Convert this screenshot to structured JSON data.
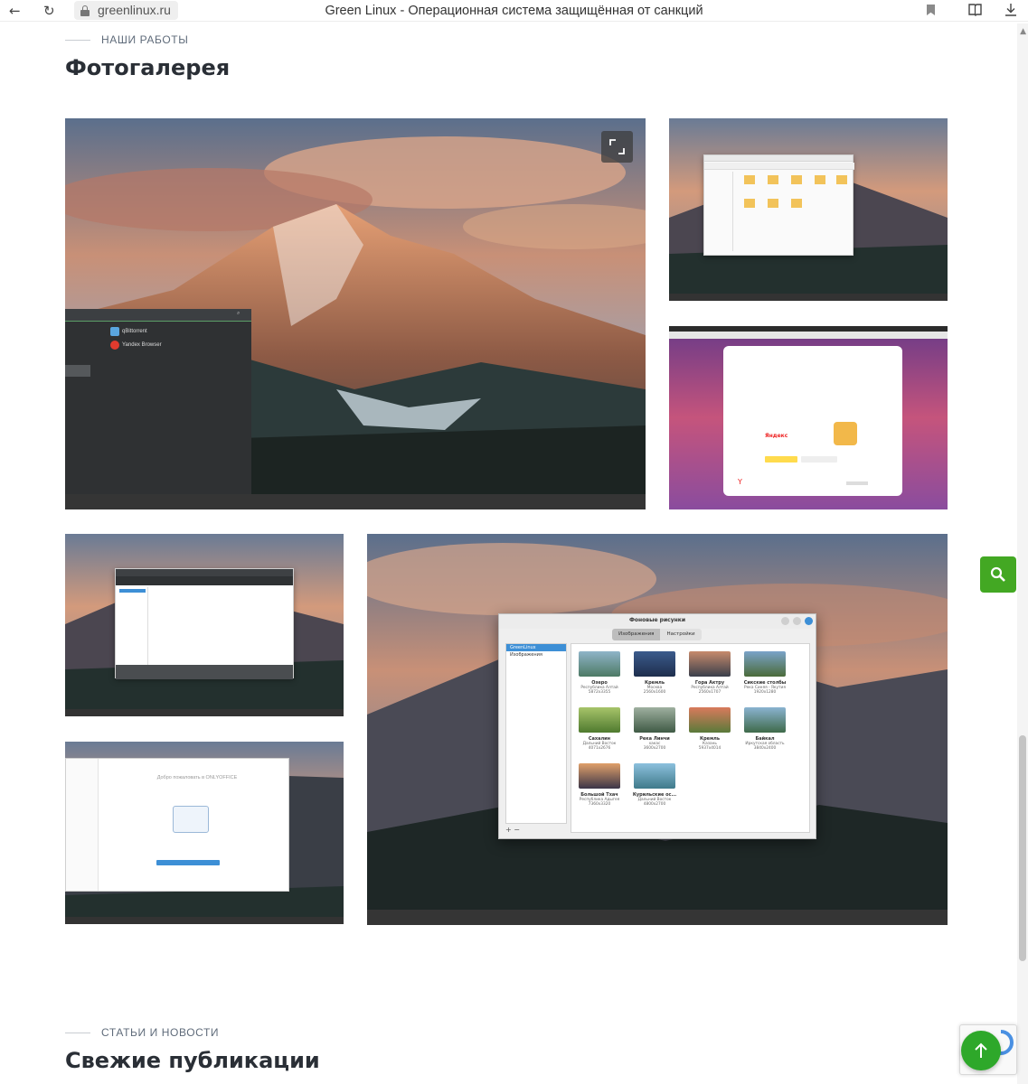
{
  "browser": {
    "url": "greenlinux.ru",
    "tab_title": "Green Linux - Операционная система защищённая от санкций"
  },
  "gallery": {
    "eyebrow": "НАШИ РАБОТЫ",
    "title": "Фотогалерея"
  },
  "tile_main": {
    "menu_items": [
      "qBittorrent",
      "Yandex Browser"
    ]
  },
  "tile_yandex": {
    "brand": "Яндекс"
  },
  "tile_wallpaper": {
    "dialog_title": "Фоновые рисунки",
    "tabs": [
      "Изображения",
      "Настройки"
    ],
    "sidebar": [
      "GreenLinux",
      "Изображения"
    ],
    "thumbs": [
      {
        "name": "Озеро",
        "sub1": "Республика Алтай",
        "sub2": "5872x3355"
      },
      {
        "name": "Кремль",
        "sub1": "Москва",
        "sub2": "2560x1600"
      },
      {
        "name": "Гора Актру",
        "sub1": "Республика Алтай",
        "sub2": "2560x1707"
      },
      {
        "name": "Сикские столбы",
        "sub1": "Река Синяя - Якутия",
        "sub2": "1920x1280"
      },
      {
        "name": "Сахалин",
        "sub1": "Дальний Восток",
        "sub2": "4071x2676"
      },
      {
        "name": "Река Линчи",
        "sub1": "хакас",
        "sub2": "3600x2700"
      },
      {
        "name": "Кремль",
        "sub1": "Казань",
        "sub2": "5937x4014"
      },
      {
        "name": "Байкал",
        "sub1": "Иркутская область",
        "sub2": "3840x2400"
      },
      {
        "name": "Большой Тхач",
        "sub1": "Республика Адыгея",
        "sub2": "7360x3320"
      },
      {
        "name": "Курильские ос...",
        "sub1": "Дальний Восток",
        "sub2": "4800x2700"
      }
    ],
    "add_remove": "+ −"
  },
  "tile_welcome": {
    "heading": "Добро пожаловать в ONLYOFFICE"
  },
  "news": {
    "eyebrow": "СТАТЬИ И НОВОСТИ",
    "title": "Свежие публикации"
  },
  "icons": {
    "back": "back-arrow-icon",
    "reload": "reload-icon",
    "bookmark": "bookmark-icon",
    "search": "search-icon",
    "up": "arrow-up-icon"
  },
  "colors": {
    "accent_green": "#43a823"
  }
}
